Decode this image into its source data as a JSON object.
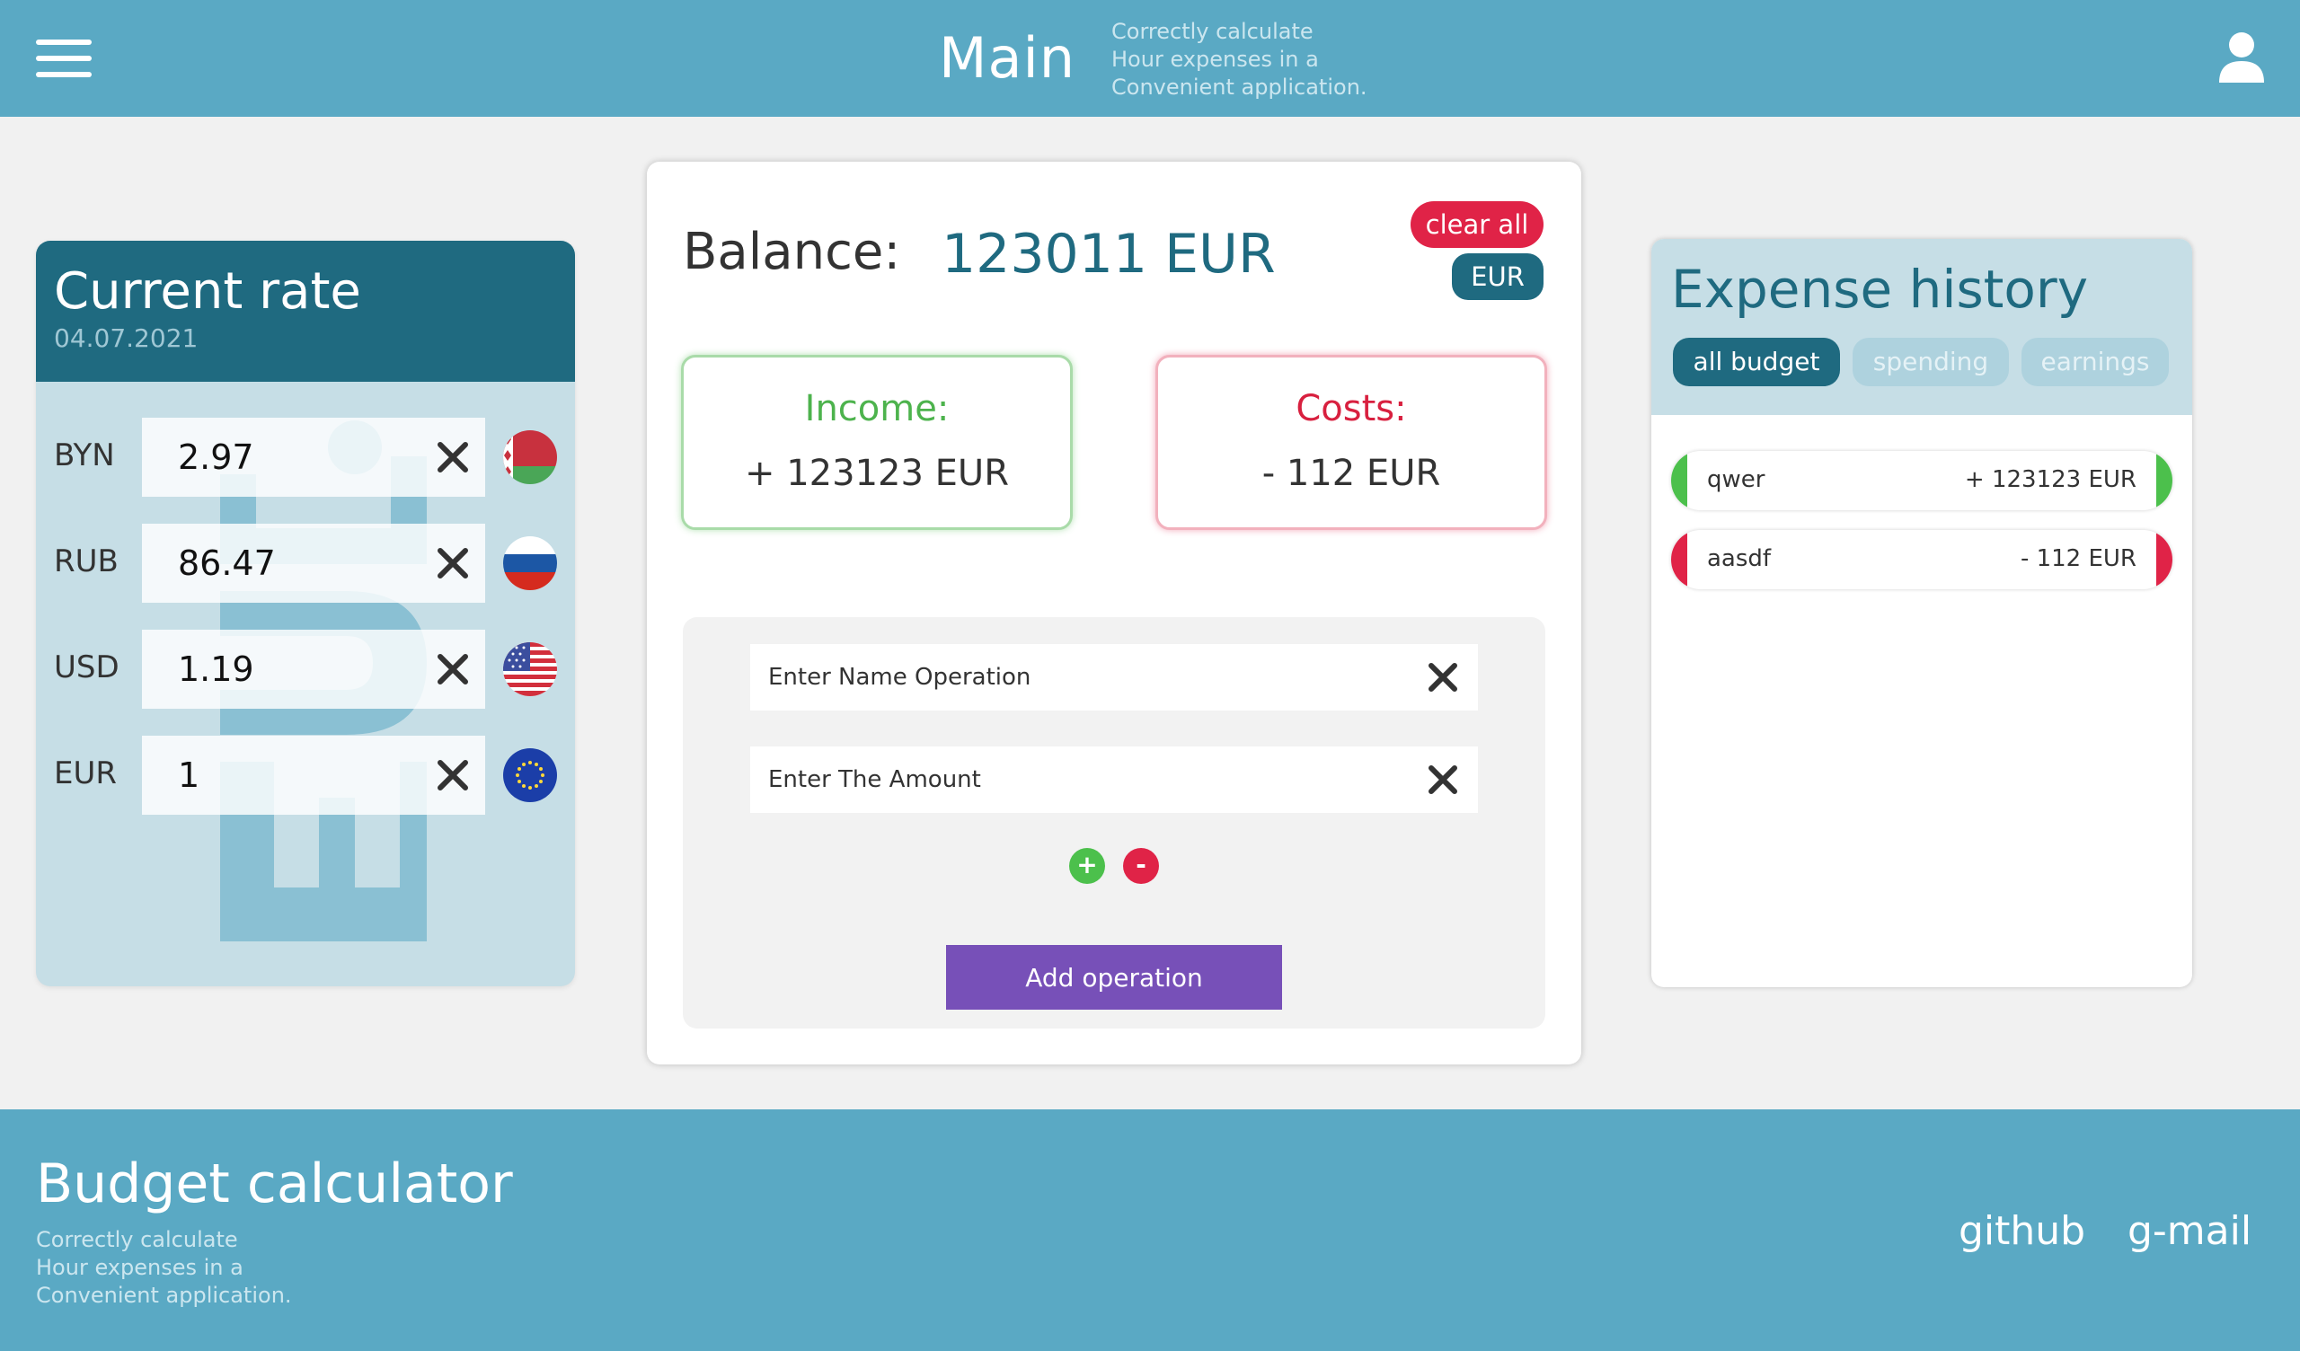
{
  "header": {
    "title": "Main",
    "subtitle": [
      "Correctly calculate",
      "Hour expenses in a",
      "Convenient application."
    ]
  },
  "rates": {
    "title": "Current rate",
    "date": "04.07.2021",
    "items": [
      {
        "code": "BYN",
        "value": "2.97",
        "flag": "belarus-flag-icon"
      },
      {
        "code": "RUB",
        "value": "86.47",
        "flag": "russia-flag-icon"
      },
      {
        "code": "USD",
        "value": "1.19",
        "flag": "usa-flag-icon"
      },
      {
        "code": "EUR",
        "value": "1",
        "flag": "eu-flag-icon"
      }
    ],
    "watermark_text": "EUR"
  },
  "balance": {
    "label": "Balance:",
    "value": "123011 EUR",
    "clear_label": "clear all",
    "currency_label": "EUR"
  },
  "income": {
    "label": "Income:",
    "value": "+ 123123 EUR"
  },
  "costs": {
    "label": "Costs:",
    "value": "- 112 EUR"
  },
  "form": {
    "name_placeholder": "Enter Name Operation",
    "amount_placeholder": "Enter The Amount",
    "plus_label": "+",
    "minus_label": "-",
    "submit_label": "Add operation"
  },
  "history": {
    "title": "Expense history",
    "tabs": [
      "all budget",
      "spending",
      "earnings"
    ],
    "items": [
      {
        "name": "qwer",
        "amount": "+ 123123 EUR",
        "kind": "income"
      },
      {
        "name": "aasdf",
        "amount": "- 112 EUR",
        "kind": "cost"
      }
    ]
  },
  "footer": {
    "title": "Budget calculator",
    "subtitle": [
      "Correctly calculate",
      "Hour expenses in a",
      "Convenient application."
    ],
    "links": [
      "github",
      "g-mail"
    ]
  },
  "colors": {
    "primary": "#5aa9c4",
    "dark": "#1f6a80",
    "income": "#4cc04c",
    "cost": "#e02347",
    "accent": "#7750b8"
  }
}
